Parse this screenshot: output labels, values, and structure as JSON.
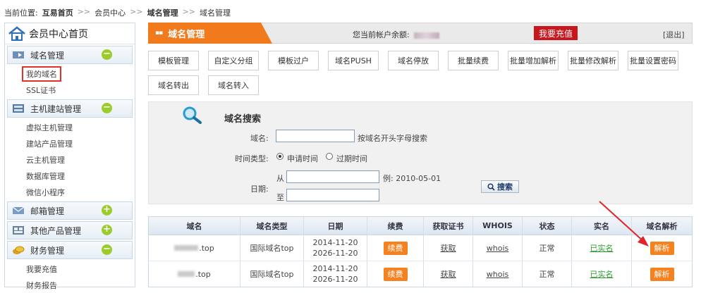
{
  "breadcrumb": {
    "prefix": "当前位置:",
    "items": [
      "互易首页",
      "会员中心",
      "域名管理",
      "域名管理"
    ],
    "sep": ">>"
  },
  "sidebar": {
    "home": "会员中心首页",
    "cat_domain": "域名管理",
    "domain_items": [
      "我的域名",
      "SSL证书"
    ],
    "cat_host": "主机建站管理",
    "host_items": [
      "虚拟主机管理",
      "建站产品管理",
      "云主机管理",
      "数据库管理",
      "微信小程序"
    ],
    "cat_mail": "邮箱管理",
    "cat_other": "其他产品管理",
    "cat_finance": "财务管理",
    "finance_items": [
      "我要充值",
      "财务报告"
    ],
    "minus": "−",
    "plus": "+"
  },
  "header": {
    "title": "域名管理",
    "balance_label": "您当前帐户余额:",
    "recharge": "我要充值",
    "logout": "[退出]"
  },
  "actions": [
    "模板管理",
    "自定义分组",
    "模板过户",
    "域名PUSH",
    "域名停放",
    "批量续费",
    "批量增加解析",
    "批量修改解析",
    "批量设置密码",
    "域名转出",
    "域名转入"
  ],
  "search": {
    "title": "域名搜索",
    "domain_label": "域名:",
    "domain_value": "",
    "domain_hint": "按域名开头字母搜索",
    "time_type_label": "时间类型:",
    "opt_apply": "申请时间",
    "opt_expire": "过期时间",
    "date_label": "日期:",
    "from": "从",
    "to": "至",
    "example": "例: 2010-05-01",
    "button": "搜索"
  },
  "table": {
    "headers": [
      "域名",
      "域名类型",
      "日期",
      "续费",
      "获取证书",
      "WHOIS",
      "状态",
      "实名",
      "域名解析"
    ],
    "rows": [
      {
        "domain_suffix": ".top",
        "type": "国际域名top",
        "date1": "2014-11-20",
        "date2": "2026-11-20",
        "renew": "续费",
        "cert": "获取",
        "whois": "whois",
        "status": "正常",
        "realname": "已实名",
        "dns": "解析"
      },
      {
        "domain_suffix": ".top",
        "type": "国际域名top",
        "date1": "2014-11-20",
        "date2": "2026-11-20",
        "renew": "续费",
        "cert": "获取",
        "whois": "whois",
        "status": "正常",
        "realname": "已实名",
        "dns": "解析"
      }
    ]
  },
  "colors": {
    "accent": "#f07a1c",
    "red": "#c8161d",
    "green_toggle": "#9ccc2c",
    "orange_btn": "#f58220"
  },
  "icons": [
    "house-icon",
    "domain-icon",
    "server-icon",
    "mail-icon",
    "grid-icon",
    "coins-icon",
    "magnifier-icon",
    "arrow-annotation"
  ]
}
